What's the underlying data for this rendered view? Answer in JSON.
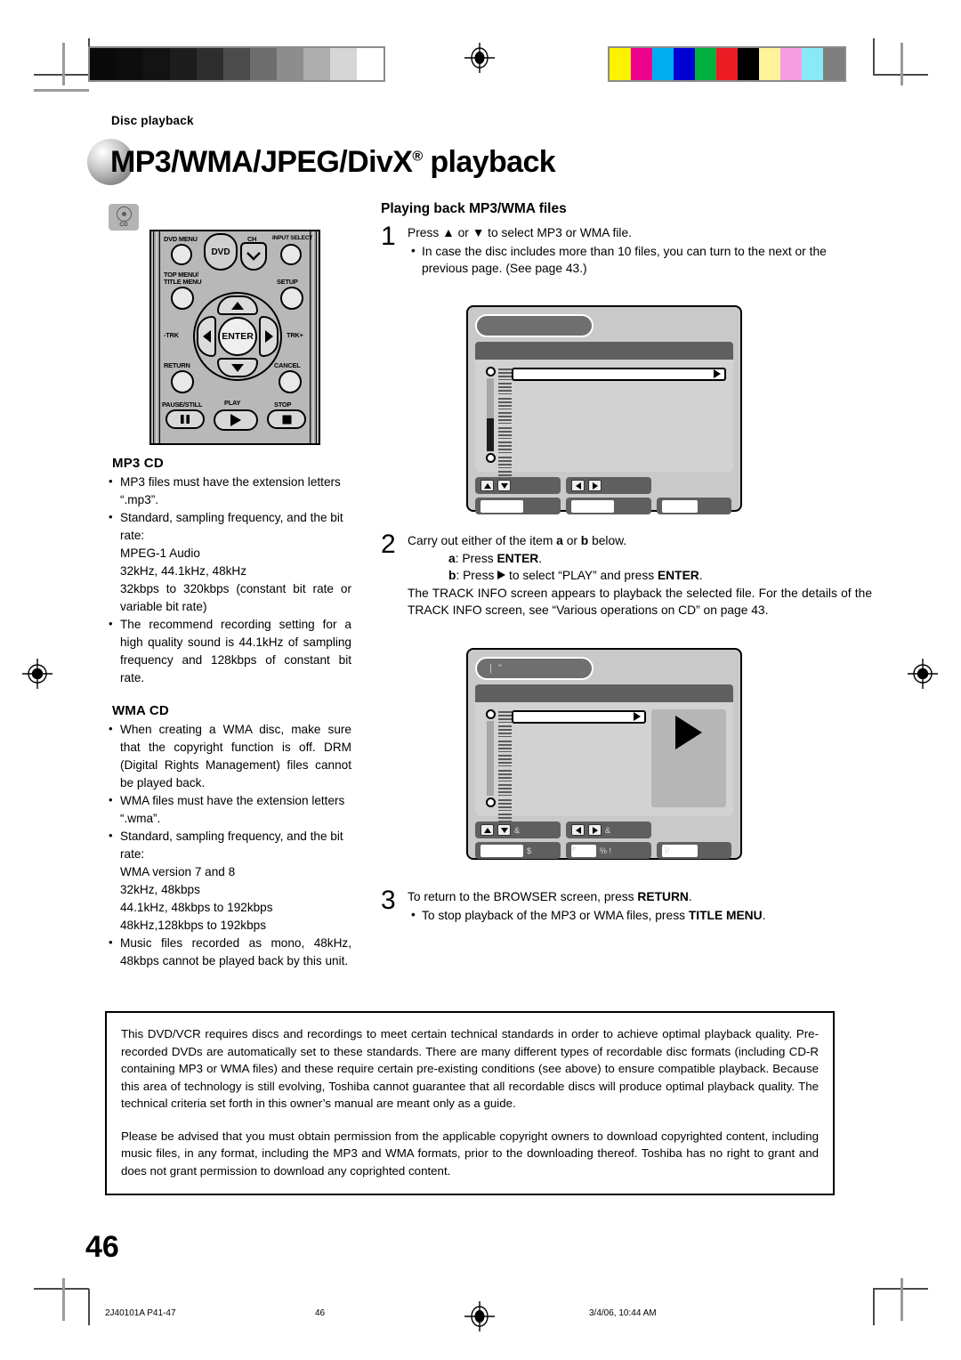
{
  "doc": {
    "kicker": "Disc playback",
    "title": "MP3/WMA/JPEG/DivX",
    "title_sup": "®",
    "title_tail": " playback",
    "page_number": "46"
  },
  "cd_badge": {
    "label": "CD"
  },
  "remote": {
    "labels": {
      "dvd_menu": "DVD MENU",
      "dvd": "DVD",
      "ch": "CH",
      "input_select": "INPUT SELECT",
      "top_menu": "TOP MENU/",
      "title_menu": "TITLE MENU",
      "setup": "SETUP",
      "trk_minus": "-TRK",
      "trk_plus": "TRK+",
      "enter": "ENTER",
      "return": "RETURN",
      "cancel": "CANCEL",
      "pause_still": "PAUSE/STILL",
      "play": "PLAY",
      "stop": "STOP"
    }
  },
  "left_column": {
    "mp3_cd": {
      "heading": "MP3 CD",
      "bullets": [
        "MP3 files must have the extension letters “.mp3”.",
        "Standard, sampling frequency, and the bit rate:",
        "The recommend recording setting for a high quality sound is 44.1kHz of sampling frequency and 128kbps of constant bit rate."
      ],
      "spec_lines": [
        "MPEG-1 Audio",
        "32kHz, 44.1kHz, 48kHz",
        "32kbps to 320kbps (constant bit rate or variable bit rate)"
      ]
    },
    "wma_cd": {
      "heading": "WMA CD",
      "bullets": [
        "When creating a WMA disc, make sure that the copyright function is off. DRM (Digital Rights Management) files cannot be played back.",
        "WMA files must have the extension letters “.wma”.",
        "Standard, sampling frequency, and the bit rate:",
        "Music files recorded as mono, 48kHz, 48kbps cannot be played back by this unit."
      ],
      "spec_lines": [
        "WMA version 7 and 8",
        "32kHz, 48kbps",
        "44.1kHz, 48kbps to 192kbps",
        "48kHz,128kbps to 192kbps"
      ]
    }
  },
  "right_column": {
    "heading": "Playing back MP3/WMA files",
    "steps": [
      {
        "number": "1",
        "line": "Press ▲ or ▼ to select MP3 or WMA file.",
        "bullets": [
          "In case the disc includes more than 10 files, you can turn to the next or the previous page. (See page 43.)"
        ]
      },
      {
        "number": "2",
        "line": "Carry out either of the item a or b below.",
        "option_a": "a: Press ENTER.",
        "option_b": "b: Press ▶ to select “PLAY” and press ENTER.",
        "tail": "The TRACK INFO screen appears to playback the selected file. For the details of the TRACK INFO screen, see “Various operations on CD” on page 43."
      },
      {
        "number": "3",
        "line": "To return to the BROWSER screen, press RETURN.",
        "bullets": [
          "To stop playback of the MP3 or WMA files, press TITLE MENU."
        ]
      }
    ]
  },
  "notice": {
    "paragraphs": [
      "This DVD/VCR requires discs and recordings to meet certain technical standards in order to achieve optimal playback quality. Pre-recorded DVDs are automatically set to these standards. There are many different types of recordable disc formats (including CD-R containing MP3 or WMA files) and these require certain pre-existing conditions (see above) to ensure compatible playback. Because this area of technology is still evolving, Toshiba cannot guarantee that all recordable discs will produce optimal playback quality. The technical criteria set forth in this owner’s manual are meant only as a guide.",
      "Please be advised that you must obtain permission from the applicable copyright owners to download copyrighted content, including music files, in any format, including the MP3 and WMA formats, prior to the downloading thereof. Toshiba has no right to grant and does not grant permission to download any coprighted content."
    ]
  },
  "footer": {
    "left": "2J40101A P41-47",
    "center": "46",
    "right": "3/4/06, 10:44 AM"
  },
  "calibration": {
    "gray_swatches": [
      "#0a0a0a",
      "#0d0d0d",
      "#131313",
      "#1d1d1d",
      "#2e2e2e",
      "#4b4b4b",
      "#6d6d6d",
      "#8d8d8d",
      "#adadad",
      "#d6d6d6",
      "#ffffff"
    ],
    "color_swatches": [
      "#fff200",
      "#ec008c",
      "#00aeef",
      "#0000d4",
      "#00b140",
      "#ed1c24",
      "#000000",
      "#fff39a",
      "#f69de0",
      "#8ae9f7",
      "#7f7f7f"
    ]
  }
}
